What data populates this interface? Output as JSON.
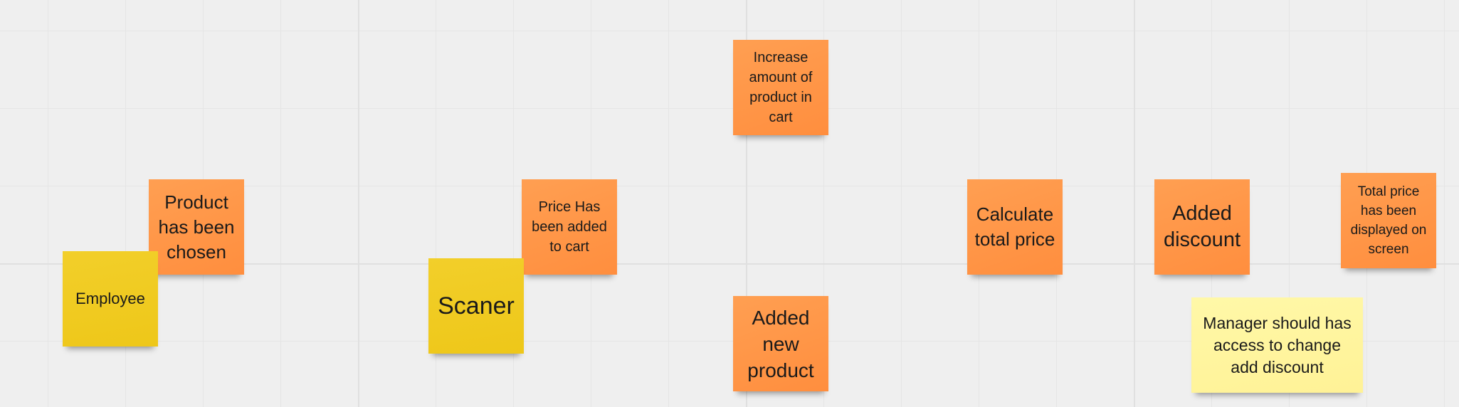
{
  "board": {
    "notes": {
      "employee": "Employee",
      "product_chosen": "Product has been chosen",
      "scaner": "Scaner",
      "price_added": "Price Has been added to cart",
      "increase_amount": "Increase amount of product in cart",
      "added_new_product": "Added new product",
      "calculate_total": "Calculate total price",
      "added_discount": "Added discount",
      "total_displayed": "Total price has been displayed on screen",
      "manager_access": "Manager should has access to change add discount"
    },
    "colors": {
      "orange": "#ff9a4d",
      "yellow": "#f0cb22",
      "pale_yellow": "#fff59b",
      "canvas": "#efefef"
    }
  }
}
